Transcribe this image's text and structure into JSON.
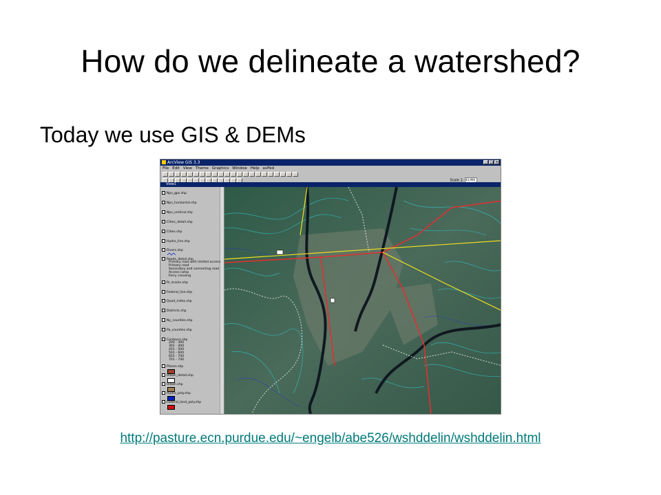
{
  "slide": {
    "title": "How do we delineate a watershed?",
    "bullet": "Today we use GIS & DEMs",
    "link": "http://pasture.ecn.purdue.edu/~engelb/abe526/wshddelin/wshddelin.html"
  },
  "screenshot": {
    "window_title": "ArcView GIS 3.3",
    "menu": [
      "File",
      "Edit",
      "View",
      "Theme",
      "Graphics",
      "Window",
      "Help",
      "avPed"
    ],
    "scale_label": "Scale 1:",
    "scale_value": "43,966",
    "view_title": "View1",
    "themes": [
      "Nps_gps.shp",
      "Nps_horizontal.shp",
      "Nps_vertical.shp",
      "Cities_detail.shp",
      "Cities.shp",
      "Hydro_line.shp",
      "Rivers.shp",
      "Roads_detail.shp",
      "Rr_tracks.shp",
      "Federal_line.shp",
      "Quad_index.shp",
      "Districts.shp",
      "Ny_counties.shp",
      "Pa_counties.shp",
      "Contours.shp",
      "Places.shp",
      "Urban_detail.shp",
      "Urban.shp",
      "Hydro_poly.shp",
      "Federal_land_poly.shp"
    ],
    "road_classes": [
      "Primary road with limited access",
      "Primary road",
      "Secondary and connecting road",
      "Access ramp",
      "Ferry crossing"
    ],
    "contour_classes": [
      "200 - 300",
      "301 - 400",
      "401 - 500",
      "501 - 600",
      "601 - 700",
      "701 - 740"
    ],
    "colors": {
      "titlebar": "#0a246a",
      "road": "#e03030",
      "highway": "#f0e020",
      "river": "#101820",
      "contour": "#30c0c0"
    }
  }
}
